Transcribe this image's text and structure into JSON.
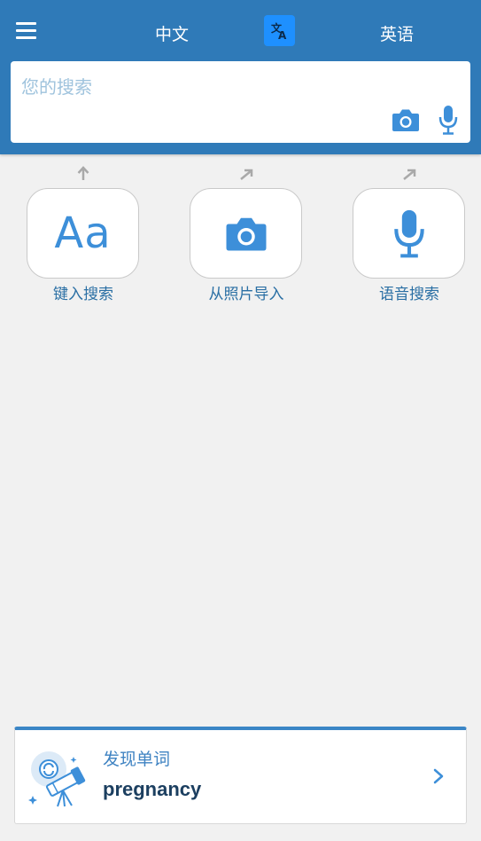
{
  "header": {
    "source_lang": "中文",
    "target_lang": "英语",
    "accent": "#2f7ab8",
    "swap_button_color": "#1e90ff"
  },
  "search": {
    "placeholder": "您的搜索",
    "value": ""
  },
  "modes": [
    {
      "icon": "text-aa-icon",
      "icon_text": "Aa",
      "label": "键入搜索"
    },
    {
      "icon": "camera-icon",
      "label": "从照片导入"
    },
    {
      "icon": "microphone-icon",
      "label": "语音搜索"
    }
  ],
  "discover": {
    "title": "发现单词",
    "word": "pregnancy",
    "icon": "telescope-icon"
  }
}
